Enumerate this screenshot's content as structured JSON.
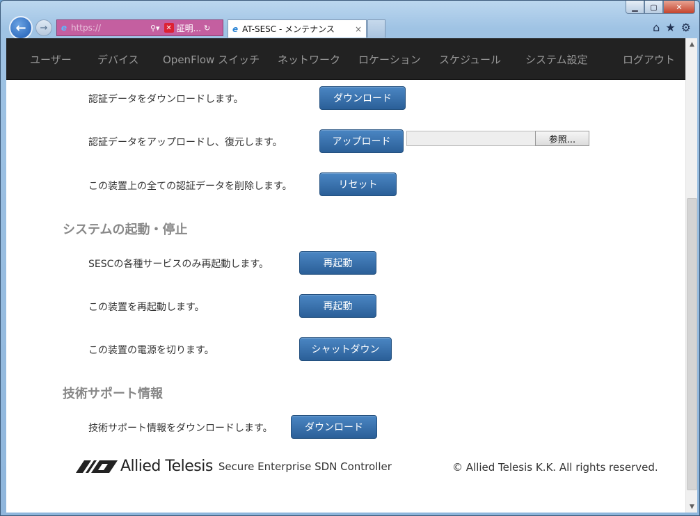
{
  "browser": {
    "address_url": "https://",
    "address_cert": "証明...",
    "tab_title": "AT-SESC - メンテナンス",
    "tab_close": "×"
  },
  "nav": {
    "items": [
      "ユーザー",
      "デバイス",
      "OpenFlow スイッチ",
      "ネットワーク",
      "ロケーション",
      "スケジュール",
      "システム設定",
      "ログアウト"
    ]
  },
  "auth": {
    "download_text": "認証データをダウンロードします。",
    "download_btn": "ダウンロード",
    "upload_text": "認証データをアップロードし、復元します。",
    "upload_btn": "アップロード",
    "browse_btn": "参照...",
    "reset_text": "この装置上の全ての認証データを削除します。",
    "reset_btn": "リセット"
  },
  "system": {
    "title": "システムの起動・停止",
    "restart_services_text": "SESCの各種サービスのみ再起動します。",
    "restart_services_btn": "再起動",
    "reboot_text": "この装置を再起動します。",
    "reboot_btn": "再起動",
    "shutdown_text": "この装置の電源を切ります。",
    "shutdown_btn": "シャットダウン"
  },
  "support": {
    "title": "技術サポート情報",
    "download_text": "技術サポート情報をダウンロードします。",
    "download_btn": "ダウンロード"
  },
  "footer": {
    "logo_text": "Allied Telesis",
    "product": "Secure Enterprise SDN Controller",
    "copyright": "© Allied Telesis K.K. All rights reserved."
  }
}
